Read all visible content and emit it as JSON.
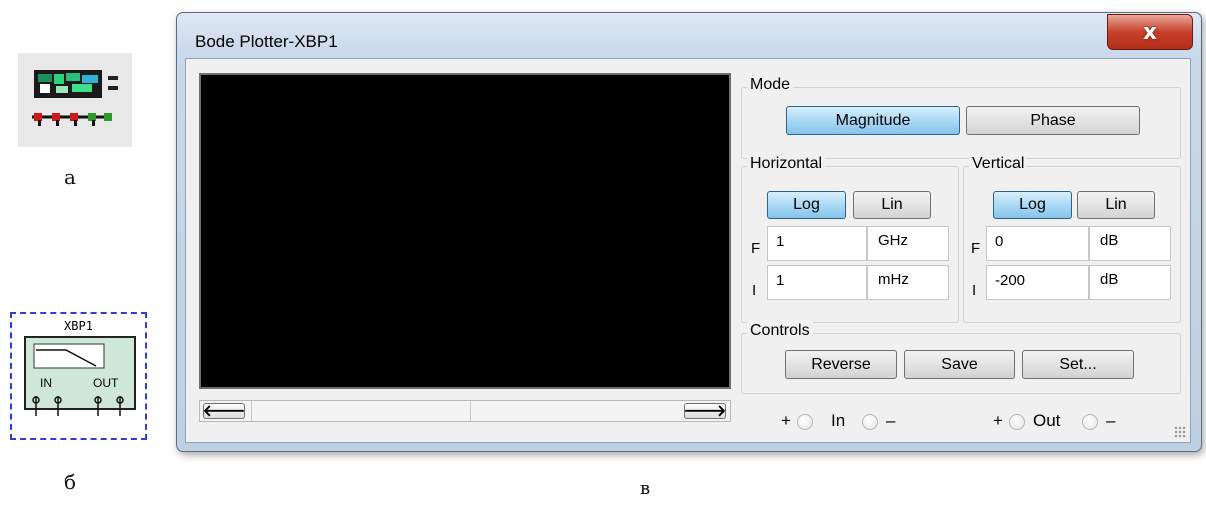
{
  "captions": {
    "a": "а",
    "b": "б",
    "c": "в"
  },
  "symbol": {
    "title": "XBP1",
    "in_label": "IN",
    "out_label": "OUT"
  },
  "window": {
    "title": "Bode Plotter-XBP1",
    "close_label": "x"
  },
  "mode": {
    "label": "Mode",
    "magnitude": "Magnitude",
    "phase": "Phase",
    "selected": "Magnitude"
  },
  "horizontal": {
    "label": "Horizontal",
    "log": "Log",
    "lin": "Lin",
    "selected": "Log",
    "f_label": "F",
    "f_value": "1",
    "f_unit": "GHz",
    "i_label": "I",
    "i_value": "1",
    "i_unit": "mHz"
  },
  "vertical": {
    "label": "Vertical",
    "log": "Log",
    "lin": "Lin",
    "selected": "Log",
    "f_label": "F",
    "f_value": "0",
    "f_unit": "dB",
    "i_label": "I",
    "i_value": "-200",
    "i_unit": "dB"
  },
  "controls": {
    "label": "Controls",
    "reverse": "Reverse",
    "save": "Save",
    "set": "Set..."
  },
  "terminals": {
    "plus": "+",
    "minus": "–",
    "in": "In",
    "out": "Out"
  },
  "scroll": {
    "left_arrow": "🡐",
    "right_arrow": "🡒"
  },
  "colors": {
    "accent_button": "#a9d9f5",
    "screen": "#000000",
    "close": "#c7402b",
    "symbol_border": "#2b3fd6",
    "symbol_fill": "#cfe7d9"
  }
}
